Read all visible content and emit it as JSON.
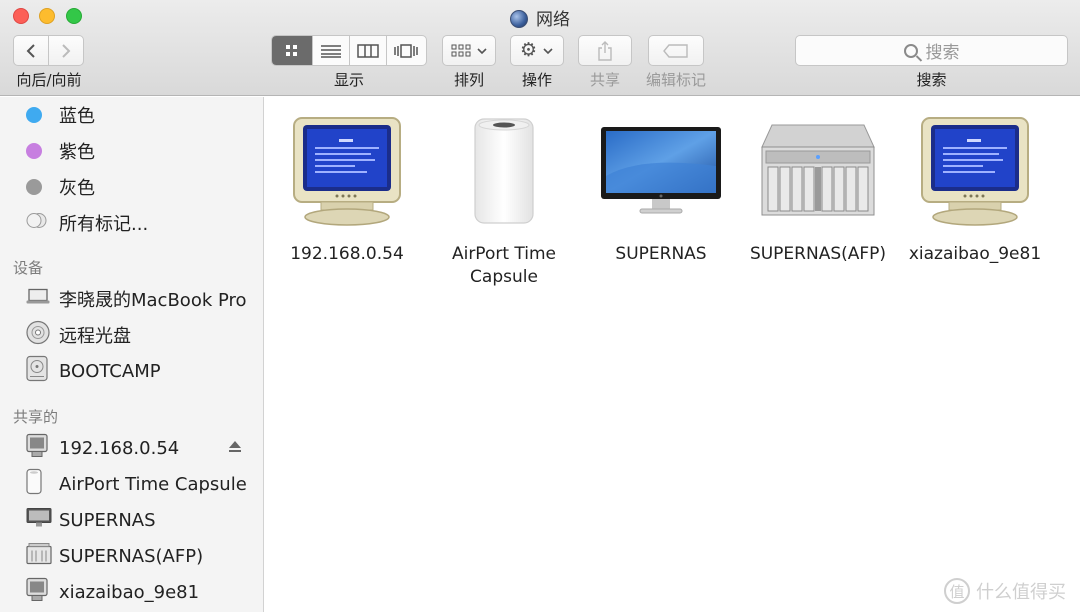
{
  "window": {
    "title": "网络",
    "icon": "globe-icon"
  },
  "toolbar": {
    "nav_label": "向后/向前",
    "view_label": "显示",
    "arrange_label": "排列",
    "action_label": "操作",
    "share_label": "共享",
    "tags_label": "编辑标记",
    "search_label": "搜索",
    "search_placeholder": "搜索",
    "active_view": "icon"
  },
  "sidebar": {
    "tags": [
      {
        "label": "蓝色",
        "color": "#3faaf0"
      },
      {
        "label": "紫色",
        "color": "#c77fe0"
      },
      {
        "label": "灰色",
        "color": "#9a9a9a"
      },
      {
        "label": "所有标记...",
        "icon": "all-tags-icon"
      }
    ],
    "devices_header": "设备",
    "devices": [
      {
        "label": "李晓晟的MacBook Pro",
        "icon": "laptop-icon"
      },
      {
        "label": "远程光盘",
        "icon": "disc-icon"
      },
      {
        "label": "BOOTCAMP",
        "icon": "hard-drive-icon"
      }
    ],
    "shared_header": "共享的",
    "shared": [
      {
        "label": "192.168.0.54",
        "icon": "computer-icon",
        "eject": true
      },
      {
        "label": "AirPort Time Capsule",
        "icon": "airport-icon"
      },
      {
        "label": "SUPERNAS",
        "icon": "display-icon"
      },
      {
        "label": "SUPERNAS(AFP)",
        "icon": "server-icon"
      },
      {
        "label": "xiazaibao_9e81",
        "icon": "computer-icon"
      }
    ]
  },
  "items": [
    {
      "name": "192.168.0.54",
      "icon": "crt-computer-icon"
    },
    {
      "name": "AirPort Time Capsule",
      "icon": "airport-time-capsule-icon"
    },
    {
      "name": "SUPERNAS",
      "icon": "cinema-display-icon"
    },
    {
      "name": "SUPERNAS(AFP)",
      "icon": "xserve-raid-icon"
    },
    {
      "name": "xiazaibao_9e81",
      "icon": "crt-computer-icon"
    }
  ],
  "watermark": {
    "text": "什么值得买",
    "glyph": "值"
  }
}
